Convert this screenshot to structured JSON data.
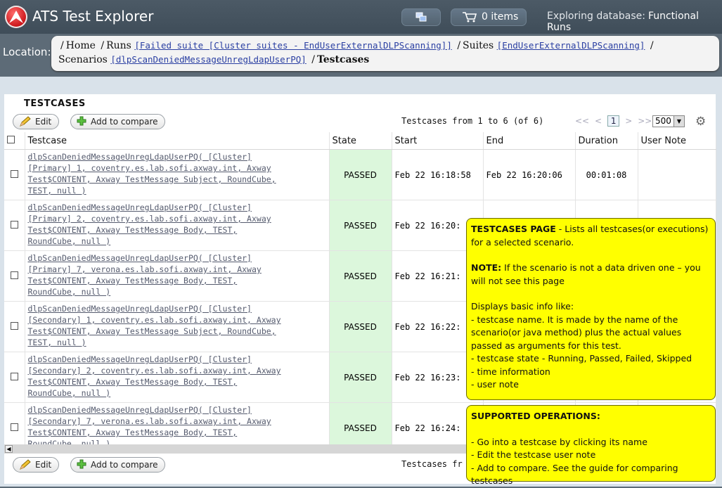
{
  "header": {
    "title": "ATS Test Explorer",
    "cart_label": "0 items",
    "db_label": "Exploring database:",
    "db_name": "Functional Runs"
  },
  "location": {
    "label": "Location:",
    "home": "Home",
    "runs": "Runs",
    "run_link": "[Failed suite [Cluster suites - EndUserExternalDLPScanning]]",
    "suites": "Suites",
    "suite_link": "[EndUserExternalDLPScanning]",
    "scenarios": "Scenarios",
    "scenario_link": "[dlpScanDeniedMessageUnregLdapUserPQ]",
    "current": "Testcases"
  },
  "panel": {
    "title": "TESTCASES",
    "edit_label": "Edit",
    "compare_label": "Add to compare",
    "pager_info": "Testcases from 1 to 6 (of 6)",
    "pager_bottom_info": "Testcases fr",
    "page": "1",
    "page_size": "500"
  },
  "columns": [
    "Testcase",
    "State",
    "Start",
    "End",
    "Duration",
    "User Note"
  ],
  "rows": [
    {
      "lines": [
        "dlpScanDeniedMessageUnregLdapUserPQ( [Cluster]",
        "[Primary] 1, coventry.es.lab.sofi.axway.int, Axway",
        "Test$CONTENT, Axway TestMessage Subject, RoundCube,",
        "TEST, null )"
      ],
      "state": "PASSED",
      "start": "Feb 22 16:18:58",
      "end": "Feb 22 16:20:06",
      "duration": "00:01:08",
      "note": ""
    },
    {
      "lines": [
        "dlpScanDeniedMessageUnregLdapUserPQ( [Cluster]",
        "[Primary] 2, coventry.es.lab.sofi.axway.int, Axway",
        "Test$CONTENT, Axway TestMessage Body, TEST,",
        "RoundCube, null )"
      ],
      "state": "PASSED",
      "start": "Feb 22 16:20:",
      "end": "",
      "duration": "",
      "note": ""
    },
    {
      "lines": [
        "dlpScanDeniedMessageUnregLdapUserPQ( [Cluster]",
        "[Primary] 7, verona.es.lab.sofi.axway.int, Axway",
        "Test$CONTENT, Axway TestMessage Body, TEST,",
        "RoundCube, null )"
      ],
      "state": "PASSED",
      "start": "Feb 22 16:21:",
      "end": "",
      "duration": "",
      "note": ""
    },
    {
      "lines": [
        "dlpScanDeniedMessageUnregLdapUserPQ( [Cluster]",
        "[Secondary] 1, coventry.es.lab.sofi.axway.int, Axway",
        "Test$CONTENT, Axway TestMessage Subject, RoundCube,",
        "TEST, null )"
      ],
      "state": "PASSED",
      "start": "Feb 22 16:22:",
      "end": "",
      "duration": "",
      "note": ""
    },
    {
      "lines": [
        "dlpScanDeniedMessageUnregLdapUserPQ( [Cluster]",
        "[Secondary] 2, coventry.es.lab.sofi.axway.int, Axway",
        "Test$CONTENT, Axway TestMessage Body, TEST,",
        "RoundCube, null )"
      ],
      "state": "PASSED",
      "start": "Feb 22 16:23:",
      "end": "",
      "duration": "",
      "note": ""
    },
    {
      "lines": [
        "dlpScanDeniedMessageUnregLdapUserPQ( [Cluster]",
        "[Secondary] 7, verona.es.lab.sofi.axway.int, Axway",
        "Test$CONTENT, Axway TestMessage Body, TEST,",
        "RoundCube, null )"
      ],
      "state": "PASSED",
      "start": "Feb 22 16:24:",
      "end": "",
      "duration": "",
      "note": ""
    }
  ],
  "note1": {
    "heading": "TESTCASES PAGE",
    "heading_rest": " - Lists all testcases(or executions) for a selected scenario.",
    "note_label": "NOTE:",
    "note_text": " If the scenario is not a data driven one – you will not see this page",
    "displays": "Displays basic info like:",
    "items": [
      " - testcase name. It is made by the name of the scenario(or java method) plus the actual values passed as arguments for this test.",
      " - testcase state - Running, Passed, Failed, Skipped",
      " - time information",
      " - user note"
    ]
  },
  "note2": {
    "heading": "SUPPORTED OPERATIONS:",
    "items": [
      " - Go into a testcase by clicking its name",
      " - Edit the testcase user note",
      " - Add to compare. See the guide for comparing testcases"
    ]
  }
}
